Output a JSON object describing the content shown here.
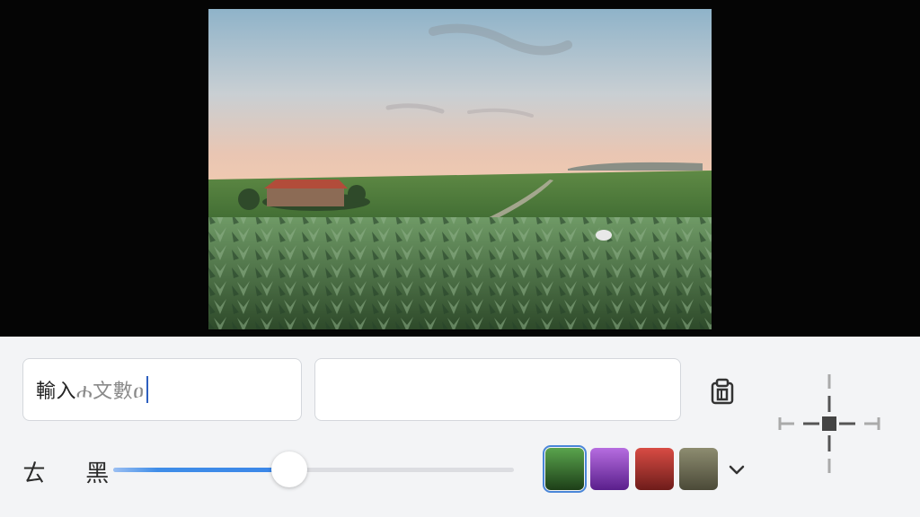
{
  "text_inputs": {
    "primary": {
      "typed": "輸入",
      "faded": "ሐ文數ዐ"
    },
    "secondary": {
      "value": "",
      "placeholder": ""
    }
  },
  "paste_icon": "clipboard-paste-icon",
  "opacity": {
    "label": "ㄊ 黑",
    "value_fraction": 0.44,
    "fill_color": "#3a86e8"
  },
  "color_swatches": [
    {
      "name": "green",
      "from": "#5aa44d",
      "to": "#1d3f18",
      "selected": true
    },
    {
      "name": "purple",
      "from": "#b66de0",
      "to": "#5a1f8c",
      "selected": false
    },
    {
      "name": "red",
      "from": "#d84c44",
      "to": "#6e1c1a",
      "selected": false
    },
    {
      "name": "olive",
      "from": "#8d8c70",
      "to": "#4b4a38",
      "selected": false
    }
  ],
  "dropdown_icon": "chevron-down-icon",
  "move_icon": "move-crosshair-icon"
}
